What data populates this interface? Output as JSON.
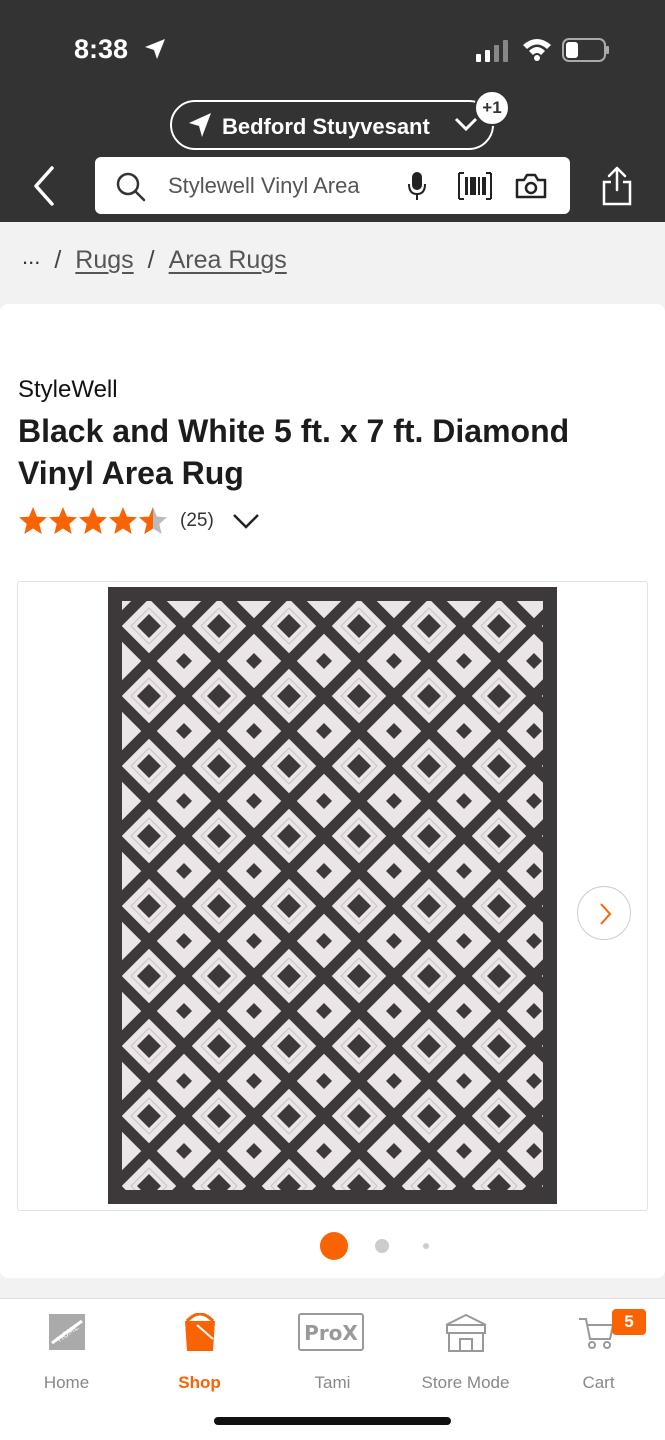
{
  "status_bar": {
    "time": "8:38"
  },
  "header": {
    "location": "Bedford Stuyvesant",
    "location_badge": "+1",
    "search_text": "Stylewell Vinyl Area"
  },
  "breadcrumb": {
    "ellipsis": "...",
    "separator": "/",
    "items": [
      "Rugs",
      "Area Rugs"
    ]
  },
  "product": {
    "brand": "StyleWell",
    "title": "Black and White 5 ft. x 7 ft. Diamond Vinyl Area Rug",
    "rating": 4.5,
    "review_count": "(25)",
    "image_count": 3,
    "current_image": 1
  },
  "bottom_nav": {
    "items": [
      {
        "label": "Home",
        "icon": "home-depot-logo-icon"
      },
      {
        "label": "Shop",
        "icon": "shop-bucket-icon",
        "active": true
      },
      {
        "label": "Tami",
        "icon": "prox-icon"
      },
      {
        "label": "Store Mode",
        "icon": "store-icon"
      },
      {
        "label": "Cart",
        "icon": "cart-icon"
      }
    ],
    "cart_count": "5"
  },
  "colors": {
    "header_bg": "#333333",
    "accent": "#f96302",
    "star": "#f96302"
  }
}
